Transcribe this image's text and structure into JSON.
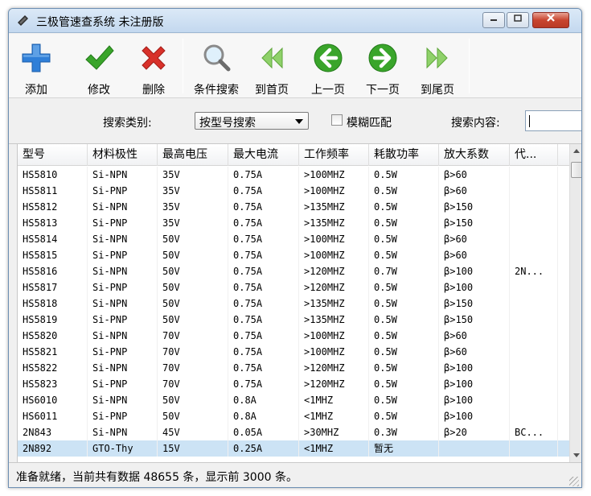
{
  "window": {
    "title": "三极管速查系统 未注册版"
  },
  "toolbar": {
    "buttons": [
      {
        "label": "添加",
        "icon": "plus-icon"
      },
      {
        "label": "修改",
        "icon": "checkmark-icon"
      },
      {
        "label": "删除",
        "icon": "x-mark-icon"
      },
      {
        "label": "条件搜索",
        "icon": "magnifier-icon"
      },
      {
        "label": "到首页",
        "icon": "first-page-icon"
      },
      {
        "label": "上一页",
        "icon": "previous-page-icon"
      },
      {
        "label": "下一页",
        "icon": "next-page-icon"
      },
      {
        "label": "到尾页",
        "icon": "last-page-icon"
      }
    ]
  },
  "search": {
    "type_label": "搜索类别:",
    "type_value": "按型号搜索",
    "fuzzy_label": "模糊匹配",
    "fuzzy_checked": false,
    "content_label": "搜索内容:",
    "content_value": ""
  },
  "table": {
    "columns": [
      "型号",
      "材料极性",
      "最高电压",
      "最大电流",
      "工作频率",
      "耗散功率",
      "放大系数",
      "代..."
    ],
    "rows": [
      [
        "HS5810",
        "Si-NPN",
        "35V",
        "0.75A",
        ">100MHZ",
        "0.5W",
        "β>60",
        ""
      ],
      [
        "HS5811",
        "Si-PNP",
        "35V",
        "0.75A",
        ">100MHZ",
        "0.5W",
        "β>60",
        ""
      ],
      [
        "HS5812",
        "Si-NPN",
        "35V",
        "0.75A",
        ">135MHZ",
        "0.5W",
        "β>150",
        ""
      ],
      [
        "HS5813",
        "Si-PNP",
        "35V",
        "0.75A",
        ">135MHZ",
        "0.5W",
        "β>150",
        ""
      ],
      [
        "HS5814",
        "Si-NPN",
        "50V",
        "0.75A",
        ">100MHZ",
        "0.5W",
        "β>60",
        ""
      ],
      [
        "HS5815",
        "Si-PNP",
        "50V",
        "0.75A",
        ">100MHZ",
        "0.5W",
        "β>60",
        ""
      ],
      [
        "HS5816",
        "Si-NPN",
        "50V",
        "0.75A",
        ">120MHZ",
        "0.7W",
        "β>100",
        "2N..."
      ],
      [
        "HS5817",
        "Si-PNP",
        "50V",
        "0.75A",
        ">120MHZ",
        "0.5W",
        "β>100",
        ""
      ],
      [
        "HS5818",
        "Si-NPN",
        "50V",
        "0.75A",
        ">135MHZ",
        "0.5W",
        "β>150",
        ""
      ],
      [
        "HS5819",
        "Si-PNP",
        "50V",
        "0.75A",
        ">135MHZ",
        "0.5W",
        "β>150",
        ""
      ],
      [
        "HS5820",
        "Si-NPN",
        "70V",
        "0.75A",
        ">100MHZ",
        "0.5W",
        "β>60",
        ""
      ],
      [
        "HS5821",
        "Si-PNP",
        "70V",
        "0.75A",
        ">100MHZ",
        "0.5W",
        "β>60",
        ""
      ],
      [
        "HS5822",
        "Si-NPN",
        "70V",
        "0.75A",
        ">120MHZ",
        "0.5W",
        "β>100",
        ""
      ],
      [
        "HS5823",
        "Si-PNP",
        "70V",
        "0.75A",
        ">120MHZ",
        "0.5W",
        "β>100",
        ""
      ],
      [
        "HS6010",
        "Si-NPN",
        "50V",
        "0.8A",
        "<1MHZ",
        "0.5W",
        "β>100",
        ""
      ],
      [
        "HS6011",
        "Si-PNP",
        "50V",
        "0.8A",
        "<1MHZ",
        "0.5W",
        "β>100",
        ""
      ],
      [
        "2N843",
        "Si-NPN",
        "45V",
        "0.05A",
        ">30MHZ",
        "0.3W",
        "β>20",
        "BC..."
      ],
      [
        "2N892",
        "GTO-Thy",
        "15V",
        "0.25A",
        "<1MHZ",
        "暂无",
        "",
        ""
      ]
    ],
    "selected_row": 17
  },
  "status": {
    "text": "准备就绪，当前共有数据 48655 条，显示前 3000 条。"
  },
  "colors": {
    "selection": "#cce3f5",
    "titlebar": "#c3d8ef",
    "close": "#c8452f"
  }
}
